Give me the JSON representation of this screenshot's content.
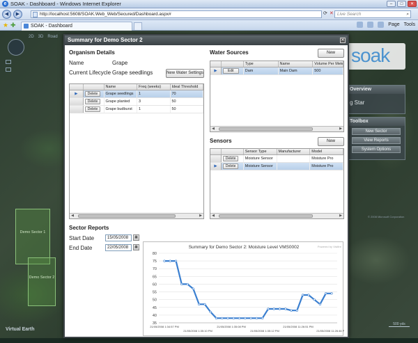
{
  "browser": {
    "window_title": "SOAK - Dashboard - Windows Internet Explorer",
    "url": "http://localhost:5608/SOAK.Web_Web/Secured/Dashboard.aspx#",
    "search_placeholder": "Live Search",
    "tab_label": "SOAK - Dashboard",
    "page_menu": "Page",
    "tools_menu": "Tools"
  },
  "map": {
    "modes": [
      "2D",
      "3D",
      "Road"
    ],
    "field_1": "Demo Sector 1",
    "field_2": "Demo Sector 2",
    "brand": "Virtual Earth",
    "scale": "500 yds",
    "copyright": "© 2008 Microsoft Corporation"
  },
  "app": {
    "logo": "soak",
    "overview_title": "Overview",
    "overview_value": "g Star",
    "toolbox_title": "Toolbox",
    "toolbox_buttons": [
      "New Sector",
      "View Reports",
      "System Options"
    ]
  },
  "modal": {
    "title": "Summary for Demo Sector 2",
    "organism": {
      "heading": "Organism Details",
      "name_label": "Name",
      "name_value": "Grape",
      "lifecycle_label": "Current Lifecycle",
      "lifecycle_value": "Grape seedlings",
      "new_water_settings": "New Water Settings",
      "columns": [
        "",
        "",
        "Name",
        "Freq (weeks)",
        "Ideal Threshold"
      ],
      "rows": [
        {
          "btn": "Delete",
          "name": "Grape seedlings",
          "freq": "1",
          "threshold": "70",
          "selected": true
        },
        {
          "btn": "Delete",
          "name": "Grape planted",
          "freq": "3",
          "threshold": "50",
          "selected": false
        },
        {
          "btn": "Delete",
          "name": "Grape budburst",
          "freq": "1",
          "threshold": "50",
          "selected": false
        }
      ]
    },
    "water": {
      "heading": "Water Sources",
      "new_button": "New",
      "columns": [
        "",
        "",
        "Type",
        "Name",
        "Volume Per Mete"
      ],
      "rows": [
        {
          "btn": "Edit",
          "type": "Dam",
          "name": "Main Dam",
          "volume": "500",
          "selected": true
        }
      ]
    },
    "sensors": {
      "heading": "Sensors",
      "new_button": "New",
      "columns": [
        "",
        "",
        "Sensor Type",
        "Manufacturer",
        "Model"
      ],
      "rows": [
        {
          "btn": "Delete",
          "type": "Moisture Sensor",
          "manufacturer": "",
          "model": "Moisture Pro",
          "selected": false
        },
        {
          "btn": "Delete",
          "type": "Moisture Sensor",
          "manufacturer": "",
          "model": "Moisture Pro",
          "selected": true
        }
      ]
    },
    "reports": {
      "heading": "Sector Reports",
      "start_label": "Start Date",
      "start_value": "15/05/2008",
      "end_label": "End Date",
      "end_value": "22/05/2008"
    }
  },
  "chart_data": {
    "type": "line",
    "title": "Summary for Demo Sector 2: Moisture Level VMS0002",
    "powered_by": "Powered by Visifire",
    "ylim": [
      35,
      80
    ],
    "yticks": [
      "80",
      "75",
      "70",
      "65",
      "60",
      "55",
      "50",
      "45",
      "40",
      "35"
    ],
    "xticks": [
      "21/05/2008 1:34:57 PM",
      "21/05/2008 1:35:10 PM",
      "21/05/2008 1:35:08 PM",
      "21/05/2008 1:35:12 PM",
      "21/05/2008 11:26:51 PM",
      "21/05/2008 11:26:46 PM"
    ],
    "grid": true,
    "color": "#3a7fd0",
    "series": [
      {
        "values": [
          75,
          75,
          75,
          60,
          60,
          57,
          47,
          47,
          42,
          38,
          38,
          38,
          38,
          38,
          38,
          38,
          38,
          38,
          44,
          44,
          44,
          44,
          43,
          43,
          53,
          53,
          50,
          47,
          54,
          54
        ]
      }
    ]
  }
}
